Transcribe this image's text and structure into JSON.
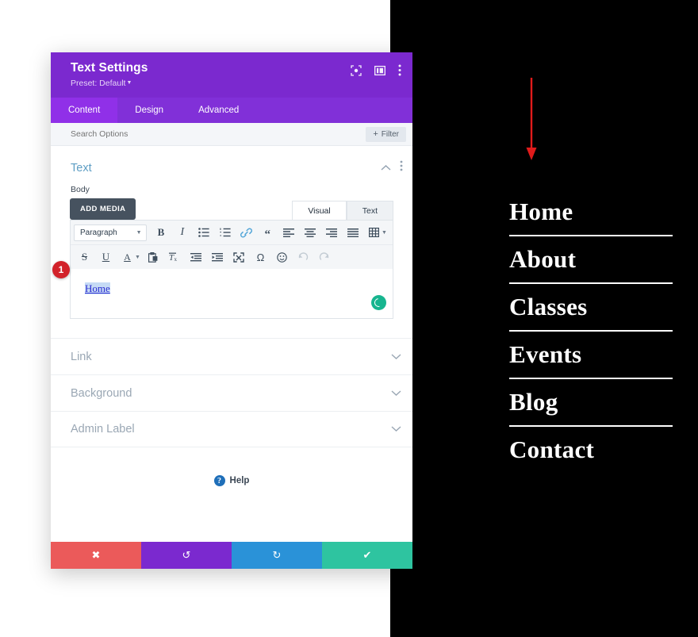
{
  "modal": {
    "title": "Text Settings",
    "preset": "Preset: Default",
    "header_icons": [
      "target-icon",
      "layout-panel-icon",
      "more-vertical-icon"
    ],
    "tabs": [
      {
        "label": "Content",
        "active": true
      },
      {
        "label": "Design",
        "active": false
      },
      {
        "label": "Advanced",
        "active": false
      }
    ],
    "search_placeholder": "Search Options",
    "filter_label": "Filter",
    "group": {
      "title": "Text",
      "collapse_icon": "chevron-up-icon",
      "menu_icon": "more-vertical-icon"
    },
    "field_label": "Body",
    "add_media_label": "ADD MEDIA",
    "editor_tabs": [
      {
        "label": "Visual",
        "active": true
      },
      {
        "label": "Text",
        "active": false
      }
    ],
    "toolbar_row1": {
      "format_select": "Paragraph",
      "items": [
        {
          "name": "bold-icon",
          "glyph": "B"
        },
        {
          "name": "italic-icon",
          "glyph": "I"
        },
        {
          "name": "bulleted-list-icon",
          "glyph": "☰"
        },
        {
          "name": "numbered-list-icon",
          "glyph": "☰"
        },
        {
          "name": "link-icon",
          "glyph": "🔗"
        },
        {
          "name": "blockquote-icon",
          "glyph": "“"
        },
        {
          "name": "align-left-icon",
          "glyph": "≡"
        },
        {
          "name": "align-center-icon",
          "glyph": "≡"
        },
        {
          "name": "align-right-icon",
          "glyph": "≡"
        },
        {
          "name": "align-justify-icon",
          "glyph": "≡"
        },
        {
          "name": "table-icon",
          "glyph": "▦"
        }
      ]
    },
    "toolbar_row2": {
      "items": [
        {
          "name": "strikethrough-icon",
          "glyph": "S"
        },
        {
          "name": "underline-icon",
          "glyph": "U"
        },
        {
          "name": "text-color-icon",
          "glyph": "A"
        },
        {
          "name": "paste-as-text-icon",
          "glyph": "📋"
        },
        {
          "name": "clear-formatting-icon",
          "glyph": "Tx"
        },
        {
          "name": "outdent-icon",
          "glyph": "⇤"
        },
        {
          "name": "indent-icon",
          "glyph": "⇥"
        },
        {
          "name": "fullscreen-icon",
          "glyph": "⤢"
        },
        {
          "name": "special-character-icon",
          "glyph": "Ω"
        },
        {
          "name": "emoji-icon",
          "glyph": "☺"
        },
        {
          "name": "undo-icon",
          "glyph": "↶",
          "disabled": true
        },
        {
          "name": "redo-icon",
          "glyph": "↷",
          "disabled": true
        }
      ]
    },
    "editor_text": "Home",
    "step_badge": "1",
    "accordion": [
      {
        "label": "Link"
      },
      {
        "label": "Background"
      },
      {
        "label": "Admin Label"
      }
    ],
    "help_label": "Help",
    "footer_buttons": [
      {
        "name": "cancel-button",
        "icon": "close-icon",
        "glyph": "✖",
        "color": "#eb5a5a"
      },
      {
        "name": "undo-button",
        "icon": "undo-icon",
        "glyph": "↺",
        "color": "#7b29cf"
      },
      {
        "name": "redo-button",
        "icon": "redo-icon",
        "glyph": "↻",
        "color": "#2a92d8"
      },
      {
        "name": "save-button",
        "icon": "check-icon",
        "glyph": "✔",
        "color": "#2ec4a0"
      }
    ]
  },
  "site_nav": {
    "items": [
      {
        "label": "Home",
        "divider": true
      },
      {
        "label": "About",
        "divider": true
      },
      {
        "label": "Classes",
        "divider": true
      },
      {
        "label": "Events",
        "divider": true
      },
      {
        "label": "Blog",
        "divider": true
      },
      {
        "label": "Contact",
        "divider": false
      }
    ]
  },
  "annotation": {
    "arrow": "down-arrow",
    "color": "#e01b1b"
  },
  "colors": {
    "modal_header": "#7b29cf",
    "tab_active": "#9030e8",
    "group_title": "#5e9ec4",
    "nav_bg": "#000000",
    "accent_green": "#2ec4a0"
  }
}
